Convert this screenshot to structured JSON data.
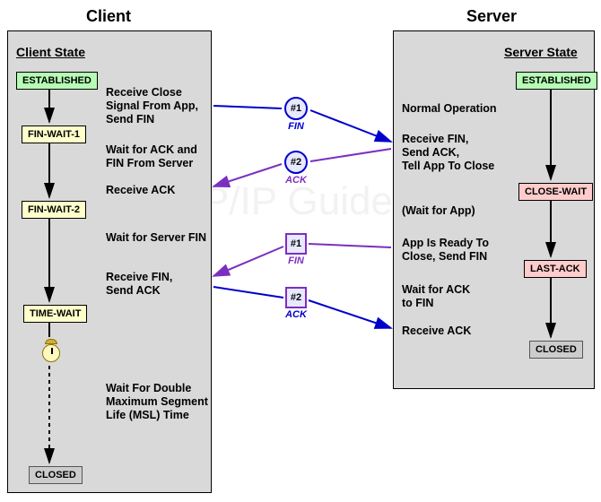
{
  "headings": {
    "client": "Client",
    "server": "Server",
    "client_state": "Client State",
    "server_state": "Server State"
  },
  "client_states": {
    "established": "ESTABLISHED",
    "fin_wait_1": "FIN-WAIT-1",
    "fin_wait_2": "FIN-WAIT-2",
    "time_wait": "TIME-WAIT",
    "closed": "CLOSED"
  },
  "server_states": {
    "established": "ESTABLISHED",
    "close_wait": "CLOSE-WAIT",
    "last_ack": "LAST-ACK",
    "closed": "CLOSED"
  },
  "client_desc": {
    "d1a": "Receive Close",
    "d1b": "Signal From App,",
    "d1c": "Send FIN",
    "d2a": "Wait for ACK and",
    "d2b": "FIN From Server",
    "d3": "Receive ACK",
    "d4": "Wait for Server FIN",
    "d5a": "Receive FIN,",
    "d5b": "Send ACK",
    "d6a": "Wait For Double",
    "d6b": "Maximum Segment",
    "d6c": "Life (MSL) Time"
  },
  "server_desc": {
    "d1": "Normal Operation",
    "d2a": "Receive FIN,",
    "d2b": "Send ACK,",
    "d2c": "Tell App To Close",
    "d3": "(Wait for App)",
    "d4a": "App Is Ready To",
    "d4b": "Close, Send FIN",
    "d5a": "Wait for ACK",
    "d5b": "to FIN",
    "d6": "Receive ACK"
  },
  "sequence": {
    "c1": "#1",
    "c2": "#2",
    "s1": "#1",
    "s2": "#2",
    "fin": "FIN",
    "ack": "ACK"
  },
  "watermark": "The TCP/IP Guide"
}
